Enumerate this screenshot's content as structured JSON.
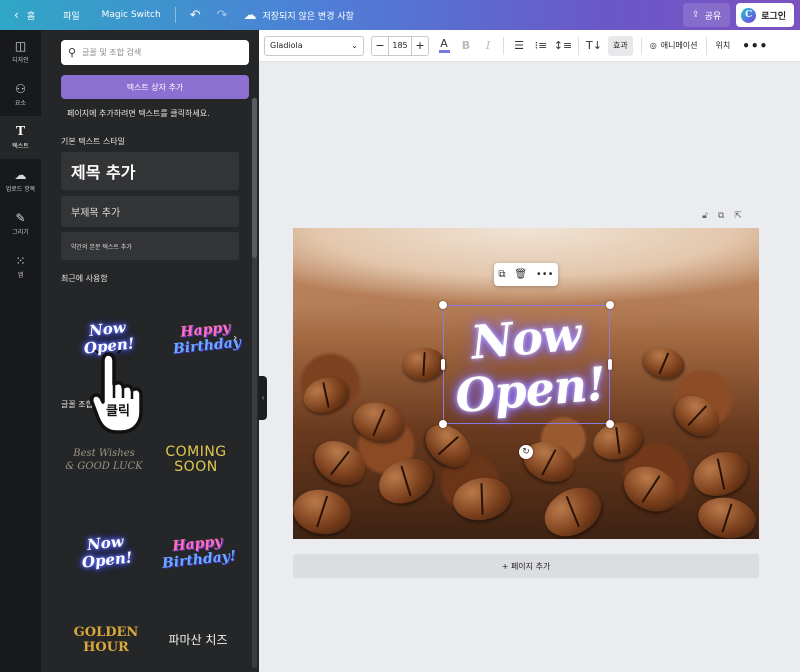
{
  "topbar": {
    "home_label": "홈",
    "file_label": "파일",
    "magic_switch_label": "Magic Switch",
    "unsaved_label": "저장되지 않은 변경 사항",
    "share_label": "공유",
    "login_label": "로그인",
    "logo_letter": "C"
  },
  "rail": {
    "items": [
      {
        "label": "디자인",
        "icon": "layout-icon"
      },
      {
        "label": "요소",
        "icon": "elements-icon"
      },
      {
        "label": "텍스트",
        "icon": "text-icon",
        "glyph": "T"
      },
      {
        "label": "업로드 항목",
        "icon": "upload-icon"
      },
      {
        "label": "그리기",
        "icon": "draw-icon"
      },
      {
        "label": "앱",
        "icon": "apps-icon"
      }
    ]
  },
  "panel": {
    "search_placeholder": "글꼴 및 조합 검색",
    "add_textbox_label": "텍스트 상자 추가",
    "hint": "페이지에 추가하려면 텍스트를 클릭하세요.",
    "default_styles_label": "기본 텍스트 스타일",
    "title_style": "제목 추가",
    "subtitle_style": "부제목 추가",
    "body_style": "약간의 본문 텍스트 추가",
    "recent_label": "최근에 사용함",
    "combos_label": "글꼴 조합",
    "recent": {
      "now_open_1": "Now",
      "now_open_2": "Open!",
      "happy_1": "Happy",
      "happy_2": "Birthday"
    },
    "combos": {
      "best_1": "Best Wishes",
      "best_2": "& GOOD LUCK",
      "coming_1": "COMING",
      "coming_2": "SOON",
      "now_open_1": "Now",
      "now_open_2": "Open!",
      "happy_1": "Happy",
      "happy_2": "Birthday!",
      "golden_1": "GOLDEN",
      "golden_2": "HOUR",
      "korean_1": "파마산 치즈"
    }
  },
  "cursor": {
    "click_label": "클릭"
  },
  "toolbar": {
    "font_name": "Gladiola",
    "font_size": "185",
    "minus": "−",
    "plus": "+",
    "effects_label": "효과",
    "animation_label": "애니메이션",
    "position_label": "위치",
    "more": "•••"
  },
  "canvas": {
    "text_line_1": "Now",
    "text_line_2": "Open!",
    "add_page_label": "+ 페이지 추가"
  },
  "colors": {
    "accent": "#8b6fd1",
    "selection": "#8b7be0"
  }
}
